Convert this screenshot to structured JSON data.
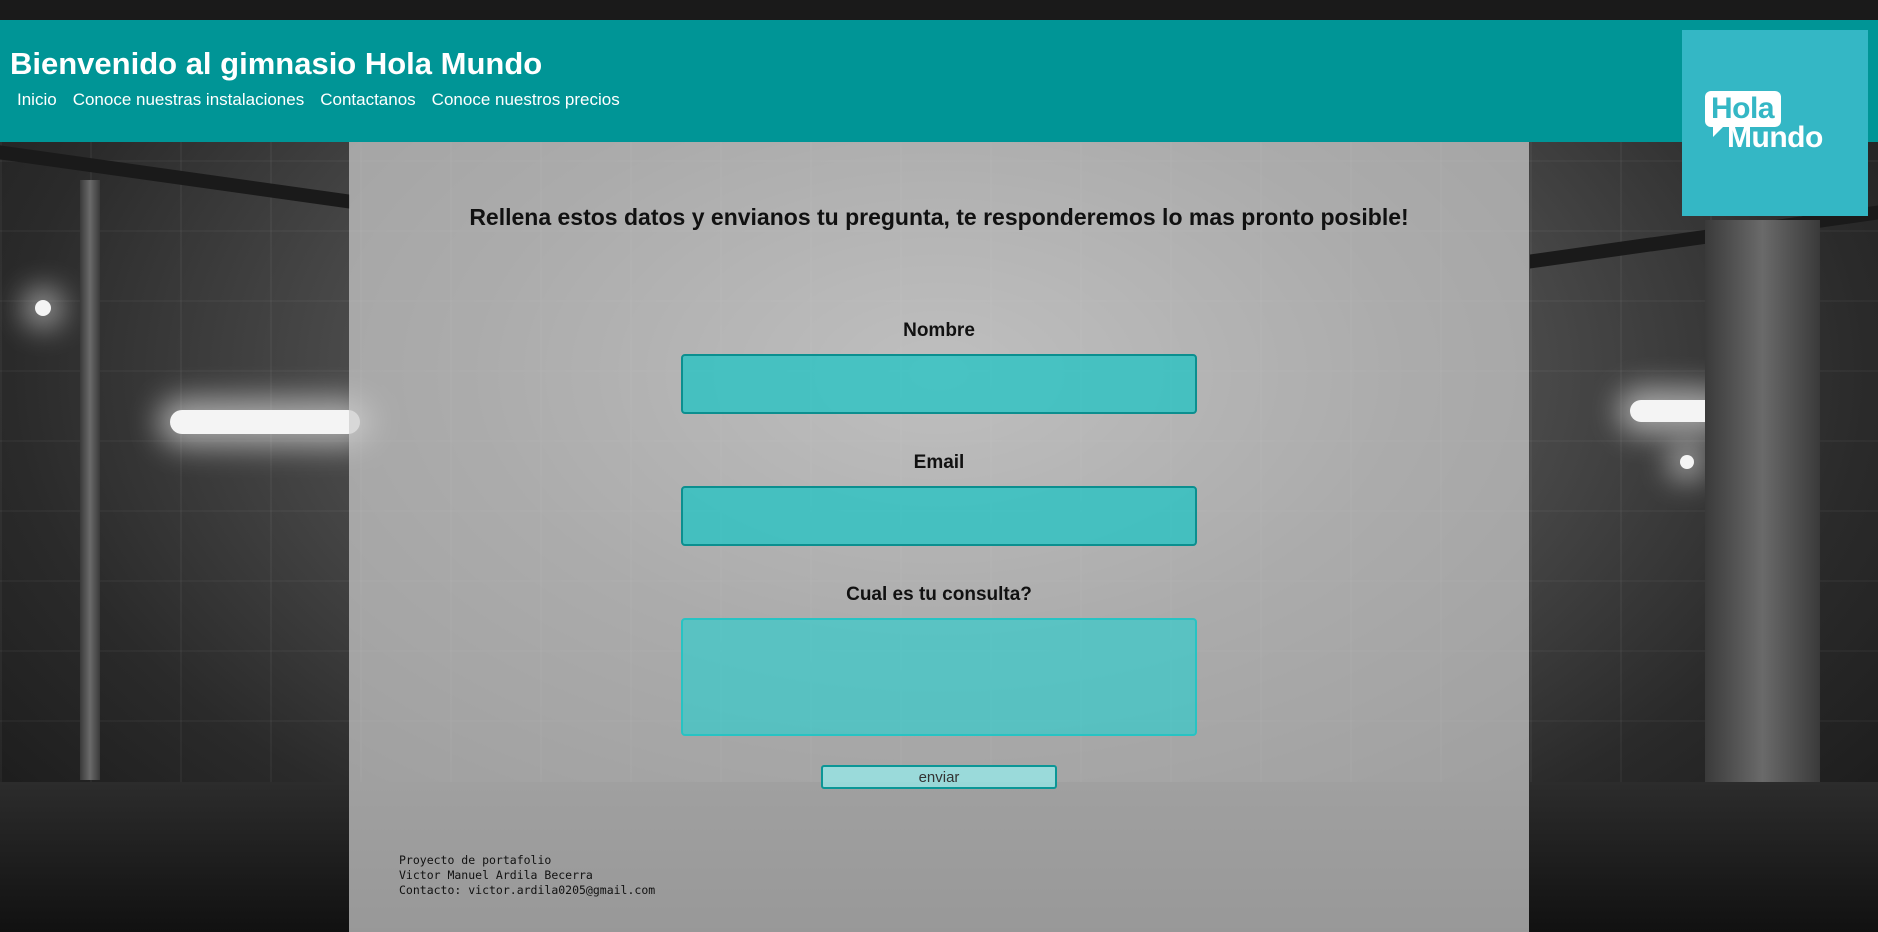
{
  "header": {
    "title": "Bienvenido al gimnasio Hola Mundo",
    "nav": [
      {
        "label": "Inicio"
      },
      {
        "label": "Conoce nuestras instalaciones"
      },
      {
        "label": "Contactanos"
      },
      {
        "label": "Conoce nuestros precios"
      }
    ]
  },
  "logo": {
    "line1": "Hola",
    "line2": "Mundo"
  },
  "form": {
    "heading": "Rellena estos datos y envianos tu pregunta, te responderemos lo mas pronto posible!",
    "name_label": "Nombre",
    "name_value": "",
    "email_label": "Email",
    "email_value": "",
    "query_label": "Cual es tu consulta?",
    "query_value": "",
    "submit_label": "enviar"
  },
  "footer": {
    "line1": "Proyecto de portafolio",
    "line2": "Victor Manuel Ardila Becerra",
    "line3": "Contacto: victor.ardila0205@gmail.com"
  },
  "colors": {
    "header_bg": "#009596",
    "logo_bg": "#34b7c5",
    "field_bg": "#20c4c4"
  }
}
